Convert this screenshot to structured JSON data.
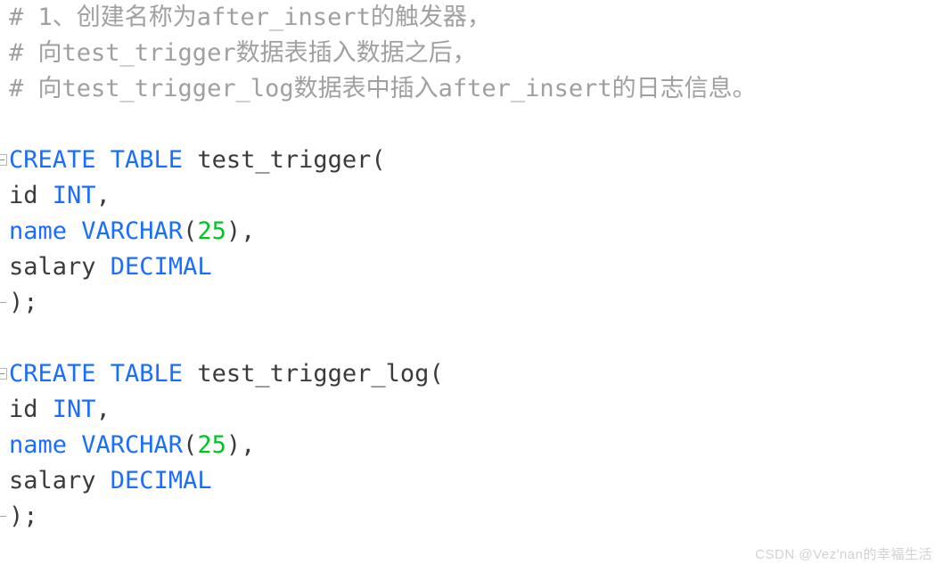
{
  "editor": {
    "background_color": "#ffffff",
    "syntax_colors": {
      "comment": "#a0a0a0",
      "keyword": "#1a6eff",
      "identifier": "#3b3b3b",
      "number": "#00c423",
      "punctuation": "#3b3b3b"
    },
    "lines": [
      {
        "id": "comment-1",
        "kind": "comment",
        "fold": "none",
        "tokens": [
          {
            "t": "# 1、创建名称为after_insert的触发器，",
            "c": "comment"
          }
        ]
      },
      {
        "id": "comment-2",
        "kind": "comment",
        "fold": "none",
        "tokens": [
          {
            "t": "# 向test_trigger数据表插入数据之后，",
            "c": "comment"
          }
        ]
      },
      {
        "id": "comment-3",
        "kind": "comment",
        "fold": "none",
        "tokens": [
          {
            "t": "# 向test_trigger_log数据表中插入after_insert的日志信息。",
            "c": "comment"
          }
        ]
      },
      {
        "id": "blank-1",
        "kind": "blank",
        "fold": "none",
        "tokens": []
      },
      {
        "id": "stmt1-create",
        "kind": "code",
        "fold": "open",
        "tokens": [
          {
            "t": "CREATE TABLE",
            "c": "keyword"
          },
          {
            "t": " ",
            "c": "punct"
          },
          {
            "t": "test_trigger",
            "c": "ident"
          },
          {
            "t": "(",
            "c": "punct"
          }
        ]
      },
      {
        "id": "stmt1-col-id",
        "kind": "code",
        "fold": "none",
        "tokens": [
          {
            "t": "id ",
            "c": "ident"
          },
          {
            "t": "INT",
            "c": "keyword"
          },
          {
            "t": ",",
            "c": "punct"
          }
        ]
      },
      {
        "id": "stmt1-col-name",
        "kind": "code",
        "fold": "none",
        "tokens": [
          {
            "t": "name VARCHAR",
            "c": "keyword"
          },
          {
            "t": "(",
            "c": "punct"
          },
          {
            "t": "25",
            "c": "number"
          },
          {
            "t": "),",
            "c": "punct"
          }
        ]
      },
      {
        "id": "stmt1-col-salary",
        "kind": "code",
        "fold": "none",
        "tokens": [
          {
            "t": "salary ",
            "c": "ident"
          },
          {
            "t": "DECIMAL",
            "c": "keyword"
          }
        ]
      },
      {
        "id": "stmt1-end",
        "kind": "code",
        "fold": "close",
        "tokens": [
          {
            "t": ");",
            "c": "punct"
          }
        ]
      },
      {
        "id": "blank-2",
        "kind": "blank",
        "fold": "none",
        "tokens": []
      },
      {
        "id": "stmt2-create",
        "kind": "code",
        "fold": "open",
        "tokens": [
          {
            "t": "CREATE TABLE",
            "c": "keyword"
          },
          {
            "t": " ",
            "c": "punct"
          },
          {
            "t": "test_trigger_log",
            "c": "ident"
          },
          {
            "t": "(",
            "c": "punct"
          }
        ]
      },
      {
        "id": "stmt2-col-id",
        "kind": "code",
        "fold": "none",
        "tokens": [
          {
            "t": "id ",
            "c": "ident"
          },
          {
            "t": "INT",
            "c": "keyword"
          },
          {
            "t": ",",
            "c": "punct"
          }
        ]
      },
      {
        "id": "stmt2-col-name",
        "kind": "code",
        "fold": "none",
        "tokens": [
          {
            "t": "name VARCHAR",
            "c": "keyword"
          },
          {
            "t": "(",
            "c": "punct"
          },
          {
            "t": "25",
            "c": "number"
          },
          {
            "t": "),",
            "c": "punct"
          }
        ]
      },
      {
        "id": "stmt2-col-salary",
        "kind": "code",
        "fold": "none",
        "tokens": [
          {
            "t": "salary ",
            "c": "ident"
          },
          {
            "t": "DECIMAL",
            "c": "keyword"
          }
        ]
      },
      {
        "id": "stmt2-end",
        "kind": "code",
        "fold": "close",
        "tokens": [
          {
            "t": ");",
            "c": "punct"
          }
        ]
      }
    ]
  },
  "watermark": {
    "text": "CSDN @Vez'nan的幸福生活",
    "color": "#d2d2d2"
  }
}
